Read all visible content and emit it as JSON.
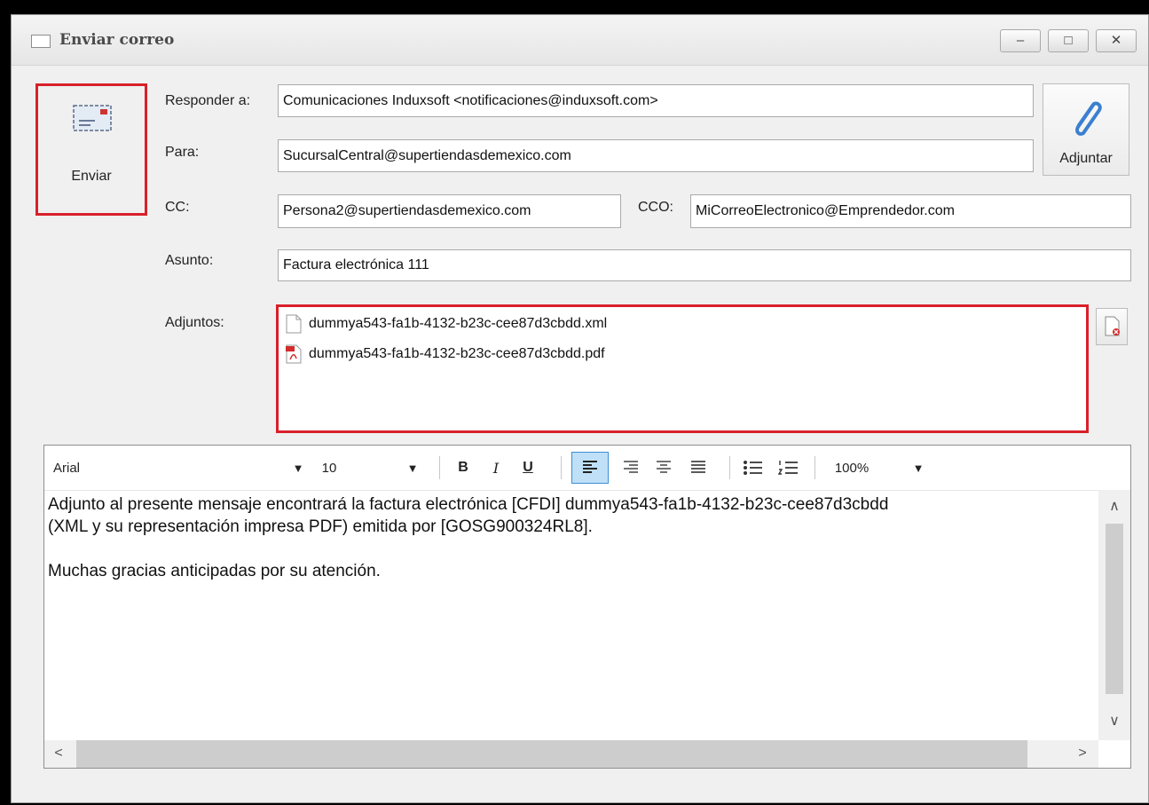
{
  "window": {
    "title": "Enviar correo",
    "controls": {
      "minimize": "–",
      "maximize": "□",
      "close": "✕"
    }
  },
  "actions": {
    "send_label": "Enviar",
    "send_icon": "envelope-icon",
    "attach_label": "Adjuntar",
    "attach_icon": "paperclip-icon",
    "highlight_color": "#d8202a"
  },
  "fields": {
    "reply_to": {
      "label": "Responder a:",
      "value": "Comunicaciones Induxsoft <notificaciones@induxsoft.com>"
    },
    "to": {
      "label": "Para:",
      "value": "SucursalCentral@supertiendasdemexico.com"
    },
    "cc": {
      "label": "CC:",
      "value": "Persona2@supertiendasdemexico.com"
    },
    "bcc": {
      "label": "CCO:",
      "value": "MiCorreoElectronico@Emprendedor.com"
    },
    "subject": {
      "label": "Asunto:",
      "value": "Factura electrónica 111"
    }
  },
  "attachments": {
    "label": "Adjuntos:",
    "items": [
      {
        "name": "dummya543-fa1b-4132-b23c-cee87d3cbdd.xml",
        "icon": "xml-file-icon"
      },
      {
        "name": "dummya543-fa1b-4132-b23c-cee87d3cbdd.pdf",
        "icon": "pdf-file-icon"
      }
    ]
  },
  "editor": {
    "font": "Arial",
    "size": "10",
    "zoom": "100%",
    "buttons": {
      "bold": "B",
      "italic": "I",
      "underline": "U"
    },
    "active_alignment": "align-left",
    "body": [
      "Adjunto al presente mensaje encontrará la factura electrónica [CFDI] dummya543-fa1b-4132-b23c-cee87d3cbdd",
      "(XML y su representación impresa PDF) emitida por [GOSG900324RL8].",
      "",
      "Muchas gracias anticipadas por su atención."
    ]
  }
}
